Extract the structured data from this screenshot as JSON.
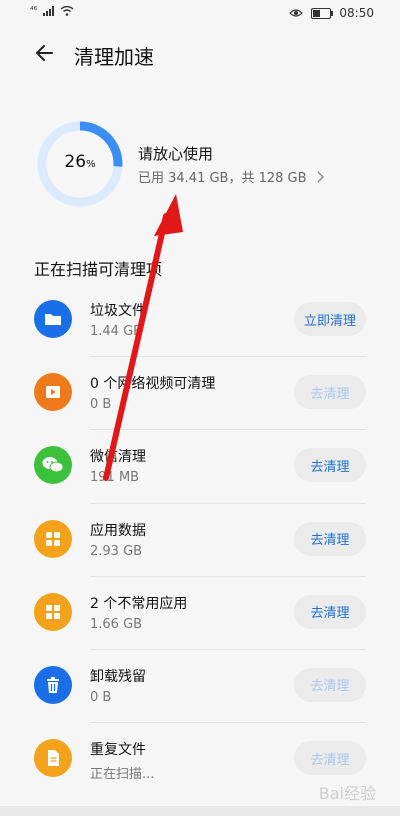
{
  "status_bar": {
    "signal": "⁴⁶",
    "time": "08:50"
  },
  "header": {
    "title": "清理加速"
  },
  "storage": {
    "percent": "26",
    "percent_unit": "%",
    "percent_value": 26,
    "title": "请放心使用",
    "detail": "已用 34.41 GB，共 128 GB",
    "ring_color": "#3b8ef5",
    "ring_track_color": "#dbeafc"
  },
  "section_title": "正在扫描可清理项",
  "items": [
    {
      "name": "垃圾文件",
      "size": "1.44 GB",
      "button": "立即清理",
      "icon": "folder-icon",
      "icon_color": "#1a6fe8",
      "enabled": true
    },
    {
      "name": "0 个网络视频可清理",
      "size": "0 B",
      "button": "去清理",
      "icon": "video-icon",
      "icon_color": "#f07a1a",
      "enabled": false
    },
    {
      "name": "微信清理",
      "size": "191 MB",
      "button": "去清理",
      "icon": "wechat-icon",
      "icon_color": "#3cc13c",
      "enabled": true
    },
    {
      "name": "应用数据",
      "size": "2.93 GB",
      "button": "去清理",
      "icon": "app-data-icon",
      "icon_color": "#f5a21b",
      "enabled": true
    },
    {
      "name": "2 个不常用应用",
      "size": "1.66 GB",
      "button": "去清理",
      "icon": "apps-grid-icon",
      "icon_color": "#f5a21b",
      "enabled": true
    },
    {
      "name": "卸载残留",
      "size": "0 B",
      "button": "去清理",
      "icon": "trash-icon",
      "icon_color": "#1a6fe8",
      "enabled": false
    },
    {
      "name": "重复文件",
      "size": "正在扫描...",
      "button": "去清理",
      "icon": "duplicate-file-icon",
      "icon_color": "#f5a21b",
      "enabled": false
    }
  ],
  "watermark": "Bai经验"
}
